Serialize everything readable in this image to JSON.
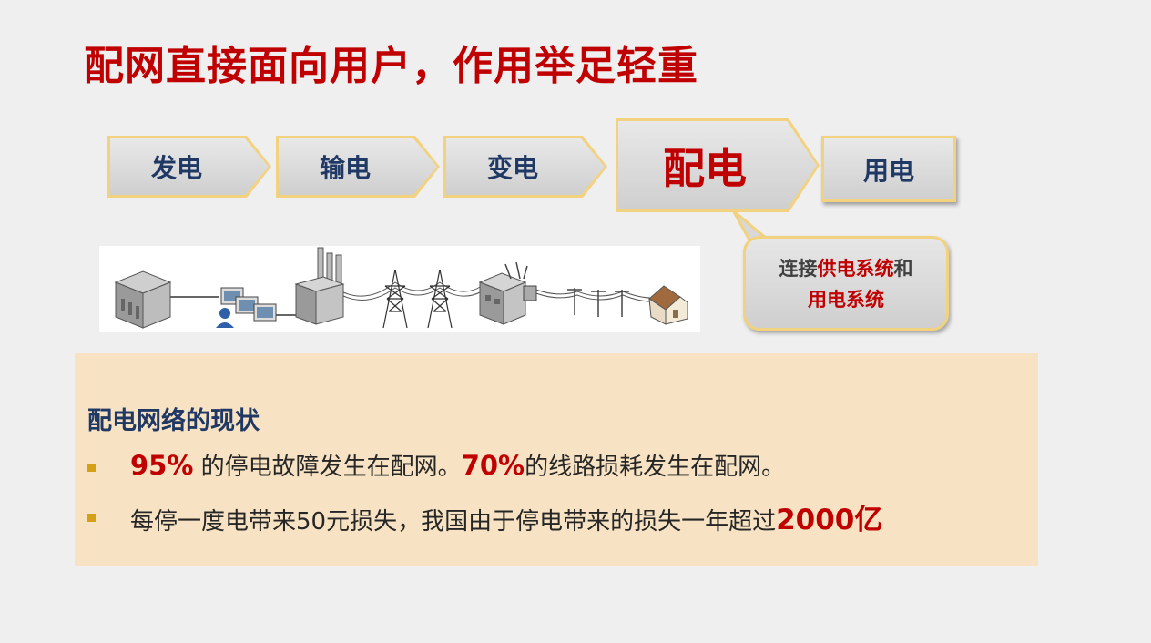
{
  "title": "配网直接面向用户，作用举足轻重",
  "chain": {
    "step1": "发电",
    "step2": "输电",
    "step3": "变电",
    "step4": "配电",
    "step5": "用电"
  },
  "callout": {
    "prefix": "连接",
    "highlight1": "供电系统",
    "mid": "和",
    "highlight2": "用电系统"
  },
  "panel": {
    "heading": "配电网络的现状",
    "bullet1": {
      "pct1": "95%",
      "text1": " 的停电故障发生在配网。",
      "pct2": "70%",
      "text2": "的线路损耗发生在配网。"
    },
    "bullet2": {
      "text": "每停一度电带来50元损失，我国由于停电带来的损失一年超过",
      "amount": "2000亿"
    }
  },
  "colors": {
    "title_red": "#c00000",
    "heading_blue": "#1f3864",
    "panel_bg": "#f7e3c3",
    "bullet_gold": "#d4a017",
    "chevron_border": "#f2d27e"
  },
  "icons": [
    "office-building-icon",
    "computer-user-icon",
    "power-plant-icon",
    "transmission-tower-icon",
    "substation-icon",
    "utility-pole-icon",
    "house-icon"
  ]
}
